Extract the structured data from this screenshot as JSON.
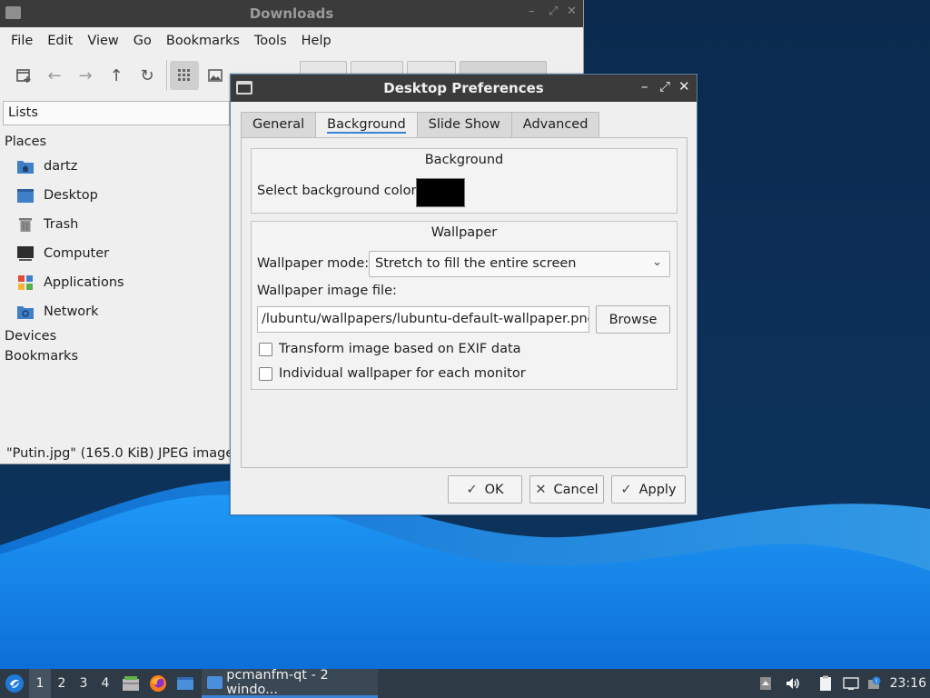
{
  "file_manager": {
    "title": "Downloads",
    "menu": [
      "File",
      "Edit",
      "View",
      "Go",
      "Bookmarks",
      "Tools",
      "Help"
    ],
    "side_header": "Lists",
    "places_label": "Places",
    "places": [
      {
        "label": "dartz",
        "icon": "home-folder-icon"
      },
      {
        "label": "Desktop",
        "icon": "desktop-icon"
      },
      {
        "label": "Trash",
        "icon": "trash-icon"
      },
      {
        "label": "Computer",
        "icon": "computer-icon"
      },
      {
        "label": "Applications",
        "icon": "applications-icon"
      },
      {
        "label": "Network",
        "icon": "network-icon"
      }
    ],
    "devices_label": "Devices",
    "bookmarks_label": "Bookmarks",
    "status": "\"Putin.jpg\" (165.0 KiB) JPEG image"
  },
  "dialog": {
    "title": "Desktop Preferences",
    "tabs": [
      "General",
      "Background",
      "Slide Show",
      "Advanced"
    ],
    "active_tab": "Background",
    "background_group": {
      "title": "Background",
      "color_label": "Select background color:",
      "color": "#000000"
    },
    "wallpaper_group": {
      "title": "Wallpaper",
      "mode_label": "Wallpaper mode:",
      "mode_value": "Stretch to fill the entire screen",
      "file_label": "Wallpaper image file:",
      "file_value": "/lubuntu/wallpapers/lubuntu-default-wallpaper.png",
      "browse_label": "Browse",
      "exif_label": "Transform image based on EXIF data",
      "individual_label": "Individual wallpaper for each monitor"
    },
    "ok_label": "OK",
    "cancel_label": "Cancel",
    "apply_label": "Apply"
  },
  "taskbar": {
    "workspaces": [
      "1",
      "2",
      "3",
      "4"
    ],
    "active_workspace": "1",
    "task_label": "pcmanfm-qt - 2 windo...",
    "clock": "23:16"
  },
  "colors": {
    "accent": "#3a83d6",
    "titlebar": "#3b3b3b",
    "desktop_dark": "#0b2a4e",
    "wave": "#1c8ff2"
  }
}
